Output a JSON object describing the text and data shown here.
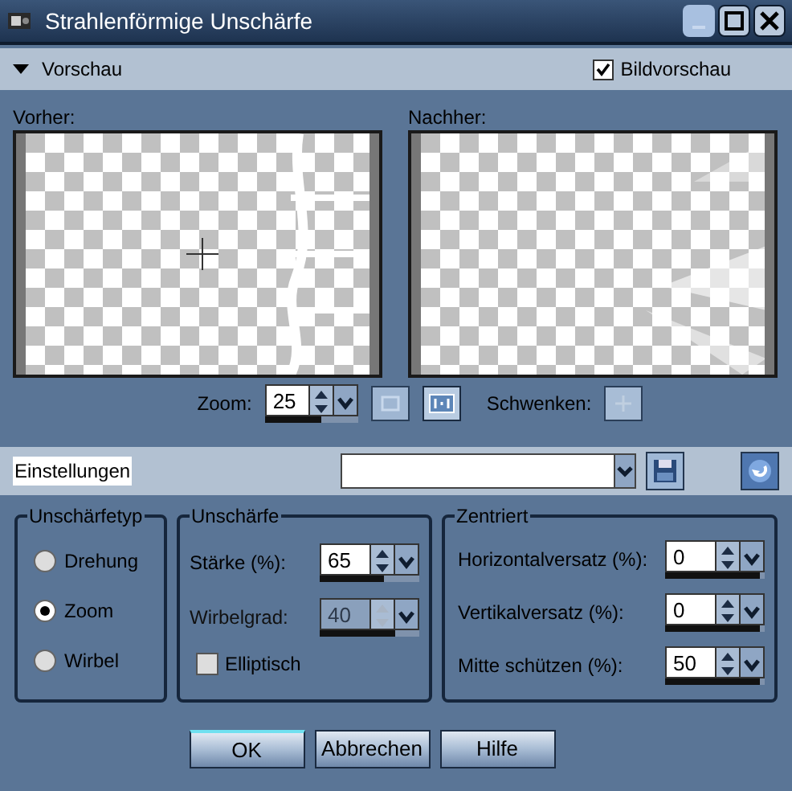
{
  "window": {
    "title": "Strahlenförmige Unschärfe"
  },
  "preview_bar": {
    "label": "Vorschau",
    "expanded": true,
    "checkbox": {
      "label": "Bildvorschau",
      "checked": true
    }
  },
  "previews": [
    {
      "label": "Vorher:",
      "kind": "before"
    },
    {
      "label": "Nachher:",
      "kind": "after"
    }
  ],
  "zoom": {
    "label": "Zoom:",
    "value": "25",
    "level": 0.6,
    "pan_label": "Schwenken:"
  },
  "settings": {
    "label": "Einstellungen"
  },
  "blur_type": {
    "title": "Unschärfetyp",
    "options": [
      {
        "label": "Drehung",
        "selected": false
      },
      {
        "label": "Zoom",
        "selected": true
      },
      {
        "label": "Wirbel",
        "selected": false
      }
    ]
  },
  "blur": {
    "title": "Unschärfe",
    "fields": [
      {
        "label": "Stärke (%):",
        "value": "65",
        "level": 0.65,
        "disabled": false
      },
      {
        "label": "Wirbelgrad:",
        "value": "40",
        "level": 0.75,
        "disabled": true
      }
    ],
    "checkbox": {
      "label": "Elliptisch",
      "checked": false
    }
  },
  "centered": {
    "title": "Zentriert",
    "fields": [
      {
        "label": "Horizontalversatz (%):",
        "value": "0",
        "level": 0.95,
        "disabled": false
      },
      {
        "label": "Vertikalversatz (%):",
        "value": "0",
        "level": 0.95,
        "disabled": false
      },
      {
        "label": "Mitte schützen (%):",
        "value": "50",
        "level": 0.95,
        "disabled": false
      }
    ]
  },
  "buttons": [
    {
      "label": "OK",
      "default": true
    },
    {
      "label": "Abbrechen",
      "default": false
    },
    {
      "label": "Hilfe",
      "default": false
    }
  ]
}
